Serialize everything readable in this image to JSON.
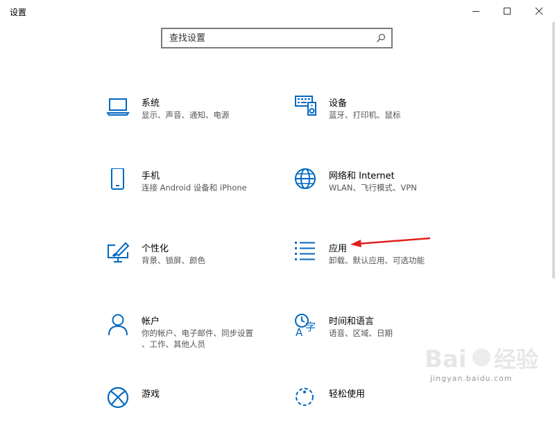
{
  "window": {
    "title": "设置"
  },
  "search": {
    "placeholder": "查找设置",
    "value": ""
  },
  "tiles": [
    {
      "icon": "laptop-icon",
      "title": "系统",
      "desc": "显示、声音、通知、电源"
    },
    {
      "icon": "keyboard-printer-icon",
      "title": "设备",
      "desc": "蓝牙、打印机、鼠标"
    },
    {
      "icon": "phone-icon",
      "title": "手机",
      "desc": "连接 Android 设备和 iPhone"
    },
    {
      "icon": "globe-icon",
      "title": "网络和 Internet",
      "desc": "WLAN、飞行模式、VPN"
    },
    {
      "icon": "paintbrush-screen-icon",
      "title": "个性化",
      "desc": "背景、锁屏、颜色"
    },
    {
      "icon": "app-list-icon",
      "title": "应用",
      "desc": "卸载、默认应用、可选功能"
    },
    {
      "icon": "person-icon",
      "title": "帐户",
      "desc": "你的帐户、电子邮件、同步设置\n、工作、其他人员"
    },
    {
      "icon": "time-language-icon",
      "title": "时间和语言",
      "desc": "语音、区域、日期"
    },
    {
      "icon": "xbox-icon",
      "title": "游戏",
      "desc": ""
    },
    {
      "icon": "ease-of-access-icon",
      "title": "轻松使用",
      "desc": ""
    }
  ],
  "colors": {
    "accent": "#0067c0",
    "annotation_arrow": "#e0201e"
  },
  "watermark": {
    "line1": "Bai 经验",
    "line2": "jingyan.baidu.com"
  }
}
